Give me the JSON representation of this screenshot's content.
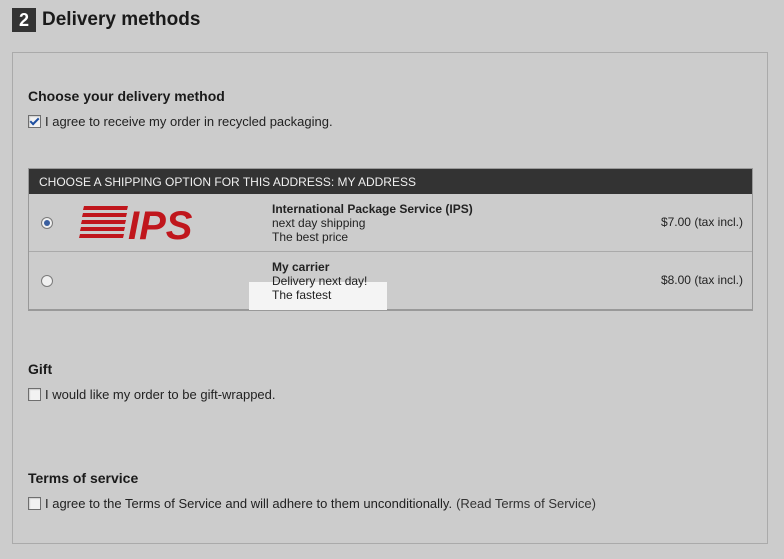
{
  "header": {
    "step_number": "2",
    "title": "Delivery methods"
  },
  "delivery": {
    "section_title": "Choose your delivery method",
    "recycled_label": "I agree to receive my order in recycled packaging.",
    "recycled_checked": true
  },
  "shipping": {
    "header": "CHOOSE A SHIPPING OPTION FOR THIS ADDRESS: MY ADDRESS",
    "options": [
      {
        "name": "International Package Service (IPS)",
        "line1": "next day shipping",
        "line2": "The best price",
        "price": "$7.00 (tax incl.)",
        "selected": true,
        "logo_text": "IPS",
        "logo_icon": "ips-logo-icon"
      },
      {
        "name": "My carrier",
        "line1": "Delivery next day!",
        "line2": "The fastest",
        "price": "$8.00 (tax incl.)",
        "selected": false
      }
    ]
  },
  "gift": {
    "section_title": "Gift",
    "label": "I would like my order to be gift-wrapped."
  },
  "terms": {
    "section_title": "Terms of service",
    "label": "I agree to the Terms of Service and will adhere to them unconditionally.",
    "link": "(Read Terms of Service)"
  },
  "colors": {
    "accent_red": "#c0161c",
    "header_dark": "#333333",
    "background": "#cccccc"
  }
}
